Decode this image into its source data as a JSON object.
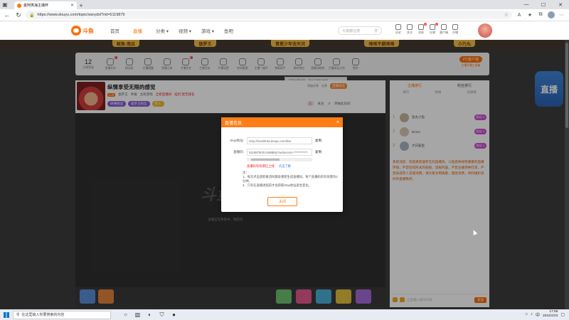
{
  "browser": {
    "tab_title": "金阿夷海主播杯",
    "new_tab": "+",
    "url": "https://www.douyu.com/topic/wsrydxl?rid=5119879"
  },
  "site": {
    "logo_text": "斗鱼",
    "nav": [
      "首页",
      "直播",
      "分类 ▾",
      "视频 ▾",
      "游戏 ▾",
      "鱼吧"
    ],
    "active_nav_index": 1,
    "search_placeholder": "大家都在搜",
    "header_icons": [
      {
        "name": "history",
        "label": "历史",
        "badge": ""
      },
      {
        "name": "follow",
        "label": "关注",
        "badge": ""
      },
      {
        "name": "message",
        "label": "消息",
        "badge": "1"
      },
      {
        "name": "gift",
        "label": "礼物",
        "badge": "1"
      },
      {
        "name": "download",
        "label": "客户端",
        "badge": ""
      },
      {
        "name": "broadcast",
        "label": "开播",
        "badge": ""
      }
    ]
  },
  "banners": [
    "鱿鱼·南瓜",
    "伽罗王",
    "青葱少年去天河",
    "咪咪不跳咪咪",
    "小乃丸"
  ],
  "activity_bar": {
    "count": "12",
    "count_label": "主播等级",
    "items": [
      {
        "label": "直播任务",
        "badge": "1"
      },
      {
        "label": "粉丝团",
        "badge": ""
      },
      {
        "label": "开播提醒",
        "badge": ""
      },
      {
        "label": "直播工具",
        "badge": ""
      },
      {
        "label": "主播任务",
        "badge": "1"
      },
      {
        "label": "主播活动",
        "badge": ""
      },
      {
        "label": "开播设置",
        "badge": ""
      },
      {
        "label": "房间管理",
        "badge": ""
      },
      {
        "label": "主播一键开",
        "badge": ""
      },
      {
        "label": "弹幕助手",
        "badge": ""
      },
      {
        "label": "我的钱包",
        "badge": ""
      },
      {
        "label": "直播间装扮",
        "badge": ""
      },
      {
        "label": "主播成长计划",
        "badge": ""
      },
      {
        "label": "更多",
        "badge": ""
      }
    ],
    "pc_button": "PC客户端",
    "pc_label": "主播开播工具箱"
  },
  "tooltip": "开播主题说明，请先开播后使用",
  "room": {
    "title": "纵情享受无限的感觉",
    "level": "Lv5",
    "anchor": "伽罗王",
    "report": "举报",
    "category": "主机游戏",
    "tag_red": "全新直播间 · 挂机 暂无排名",
    "anti": "添加分享",
    "share": "分享",
    "tags": [
      "纵横挑战",
      "伽罗王粉丝",
      "新人"
    ],
    "rank": "直播排名",
    "gift_count": "2",
    "stats": [
      "关注",
      "0",
      "举报此房间"
    ]
  },
  "player": {
    "watermark": "斗鱼",
    "offline_text": "主播正在休息中，稍后见"
  },
  "chat": {
    "tabs": [
      "主播排行",
      "粉丝排行"
    ],
    "active_tab": 0,
    "sub_tabs": [
      "排行",
      "周榜",
      "贡献榜"
    ],
    "ranks": [
      {
        "num": "1",
        "name": "鱼丸小鱼",
        "pill": "粉丝 3"
      },
      {
        "num": "2",
        "name": "kimiro",
        "pill": "粉丝 2"
      },
      {
        "num": "3",
        "name": "大白鲨鱼",
        "pill": "粉丝 1"
      }
    ],
    "system_msg": "系统消息：欢迎来到伽罗王的直播间。斗鱼倡导绿色健康的直播环境，严禁任何形式的低俗、违规内容，严禁主播诱导打赏，严禁未成年人充值消费。请大家文明观看，理性消费，共同维护良好的直播秩序。",
    "input_placeholder": "这里输入聊天内容",
    "send": "发送"
  },
  "modal": {
    "title": "直播信息",
    "close": "×",
    "rtmp_label": "rtmp地址:",
    "rtmp_value": "rtmp://sendtc3a.douyu.com/live",
    "copy": "复制",
    "key_label": "直播码:",
    "key_value": "5119879rOrUxMBMy?wsSecret=************",
    "warn": "直播码有效期已上线",
    "learn_more": "点击了解",
    "note_title": "注：",
    "notes": [
      "1、每次点击获取推流码都会重新生成直播码，每个直播码的有效期为2分钟。",
      "2、只有在直播进程前才会获取rtmp地址发生变化。"
    ],
    "button": "关闭"
  },
  "taskbar": {
    "search_placeholder": "在这里输入你要搜索的内容",
    "time": "17:59",
    "date": "2022/2/23"
  },
  "deco_text": "直播"
}
